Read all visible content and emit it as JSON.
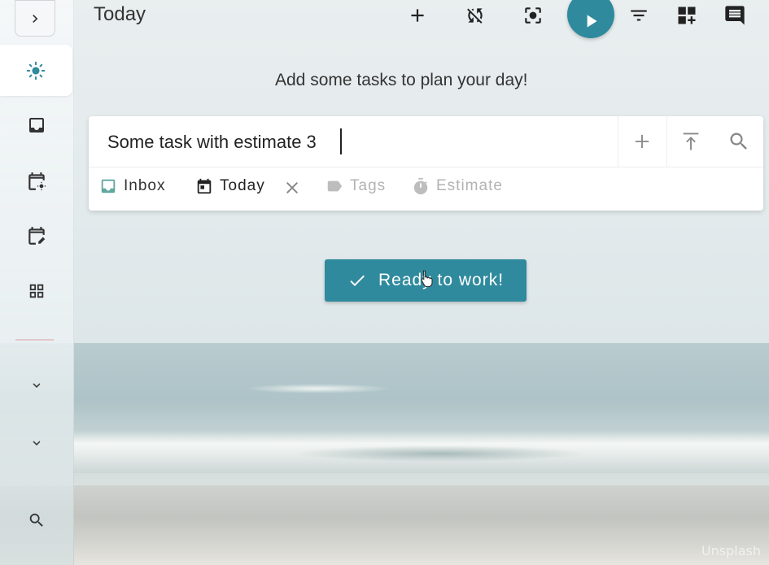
{
  "header": {
    "title": "Today",
    "icons": [
      "add-icon",
      "sync-disabled-icon",
      "focus-icon",
      "play-icon",
      "filter-icon",
      "add-widget-icon",
      "comment-icon"
    ],
    "accent_color": "#2f8a9d"
  },
  "sidebar": {
    "items": [
      {
        "name": "expand",
        "icon": "chevron-right-icon"
      },
      {
        "name": "today",
        "icon": "sun-icon",
        "active": true
      },
      {
        "name": "inbox",
        "icon": "inbox-icon"
      },
      {
        "name": "scheduled",
        "icon": "calendar-sun-icon"
      },
      {
        "name": "planner",
        "icon": "calendar-edit-icon"
      },
      {
        "name": "boards",
        "icon": "grid-icon"
      },
      {
        "name": "projects",
        "icon": "chevron-down-icon"
      },
      {
        "name": "tags",
        "icon": "chevron-down-icon"
      },
      {
        "name": "search",
        "icon": "search-icon"
      }
    ]
  },
  "main": {
    "hint": "Add some tasks to plan your day!",
    "add_task": {
      "value": "Some task with estimate 3",
      "buttons": [
        "add-icon",
        "add-to-top-icon",
        "search-icon"
      ],
      "meta": {
        "inbox": "Inbox",
        "today": "Today",
        "tags": "Tags",
        "estimate": "Estimate"
      }
    },
    "ready_button": "Ready to work!"
  },
  "watermark": "Unsplash"
}
